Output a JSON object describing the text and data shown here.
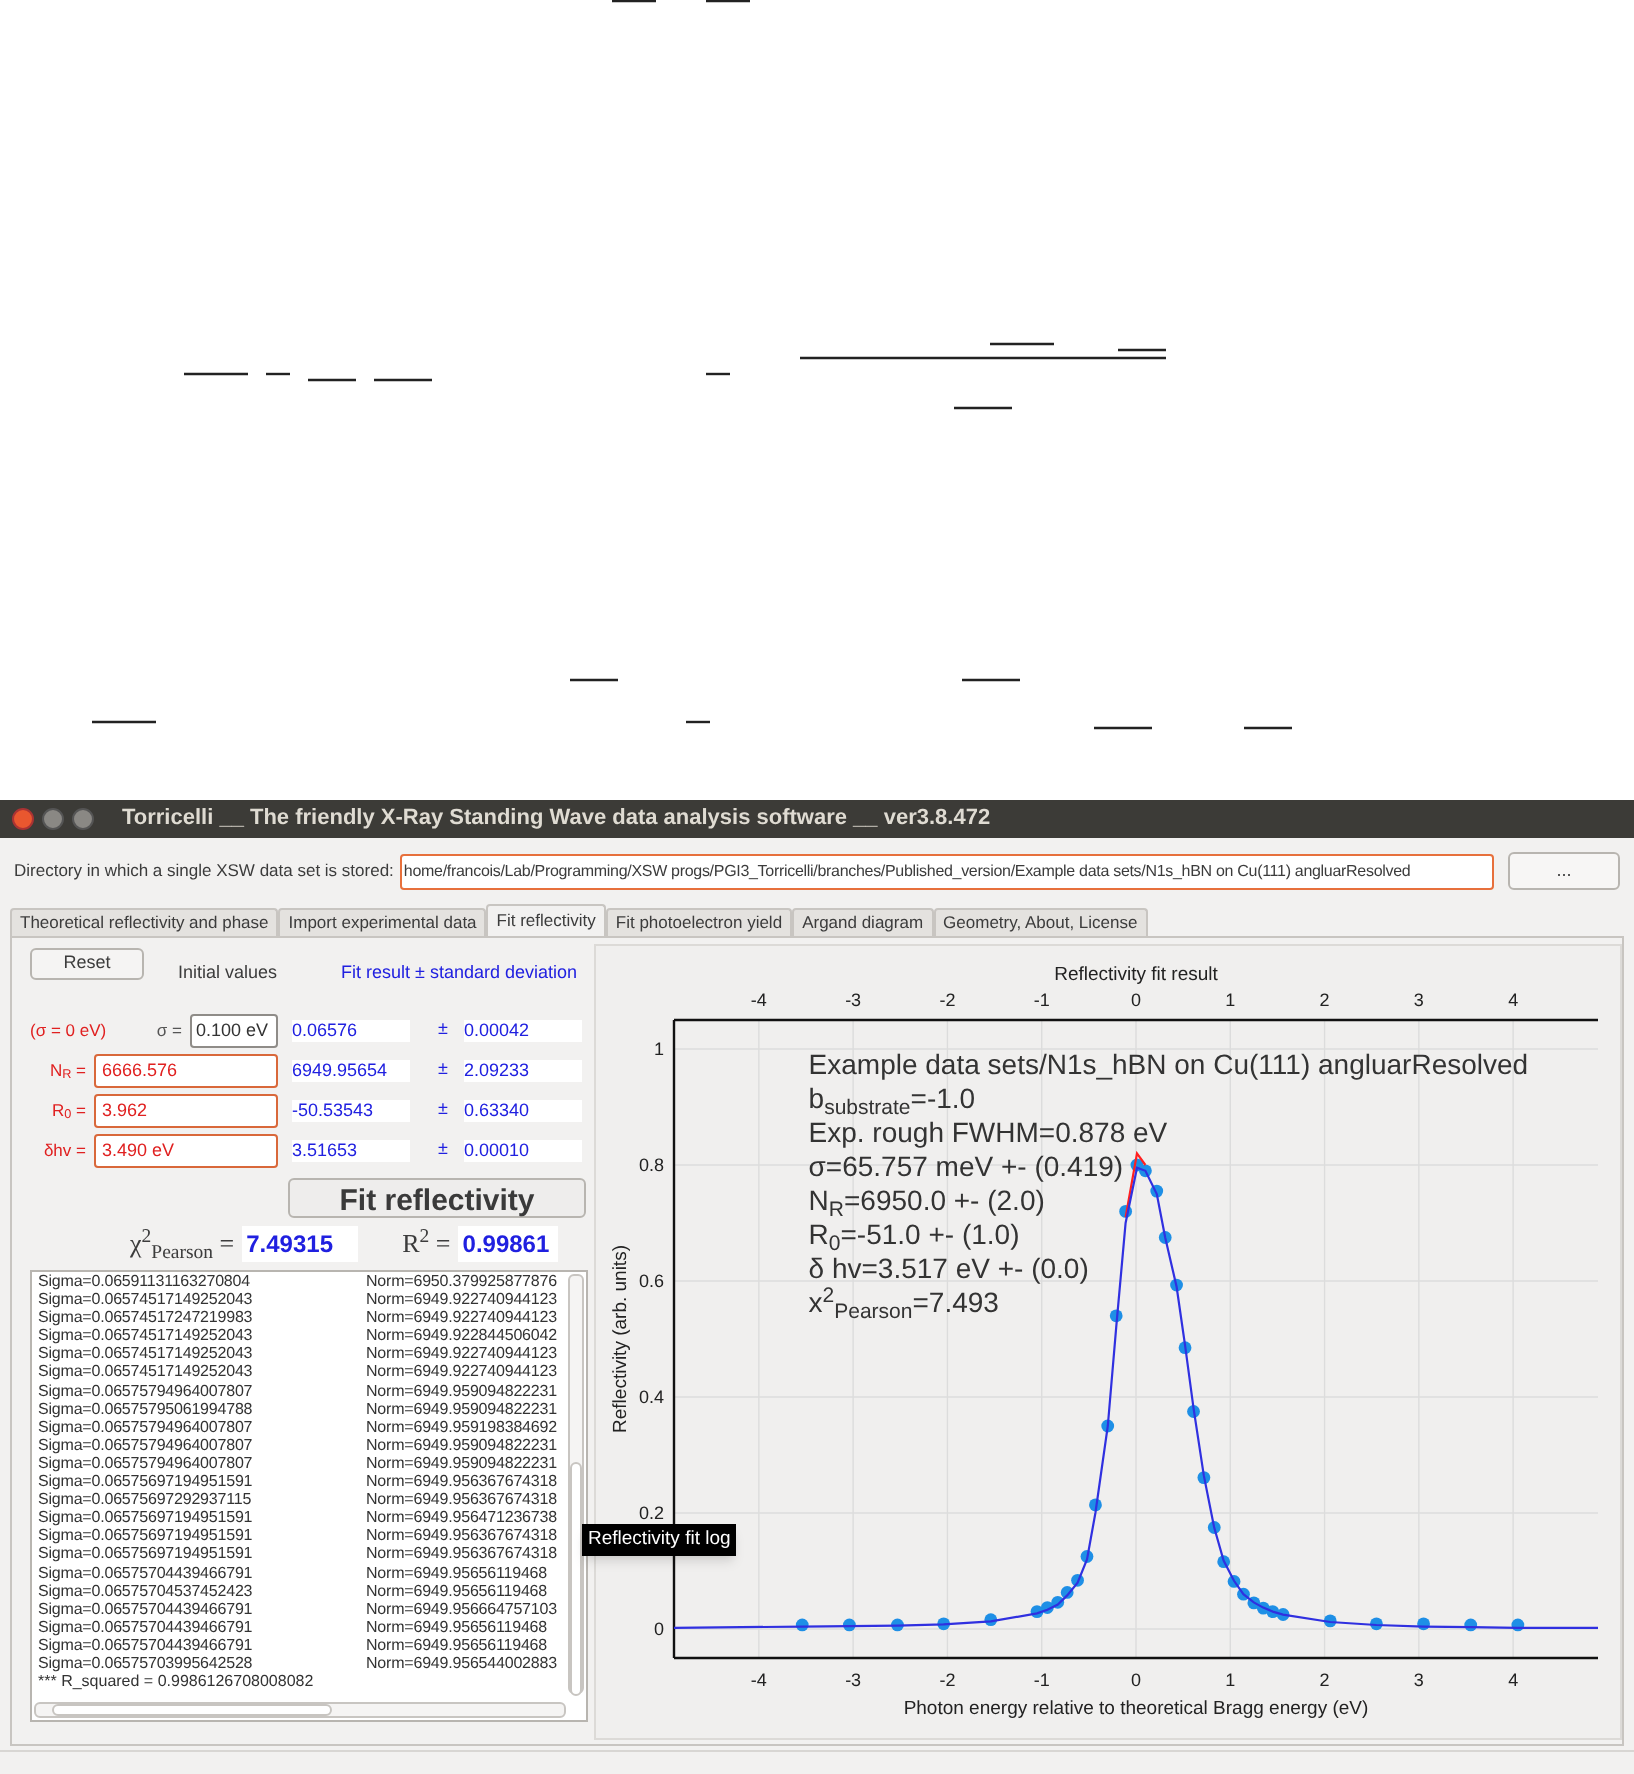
{
  "window": {
    "title": "Torricelli __ The friendly X-Ray Standing Wave data analysis software __ ver3.8.472"
  },
  "directory": {
    "label": "Directory in which a single XSW data set is stored:",
    "value": "home/francois/Lab/Programming/XSW progs/PGI3_Torricelli/branches/Published_version/Example data sets/N1s_hBN on Cu(111) angluarResolved",
    "button": "..."
  },
  "tabs": [
    {
      "label": "Theoretical reflectivity and phase",
      "selected": false
    },
    {
      "label": "Import experimental data",
      "selected": false
    },
    {
      "label": "Fit reflectivity",
      "selected": true
    },
    {
      "label": "Fit photoelectron yield",
      "selected": false
    },
    {
      "label": "Argand diagram",
      "selected": false
    },
    {
      "label": "Geometry, About, License",
      "selected": false
    }
  ],
  "fit_panel": {
    "reset_button": "Reset",
    "initial_values_header": "Initial values",
    "fit_result_header": "Fit result ± standard deviation",
    "parameters": [
      {
        "note": "(σ = 0 eV)",
        "label": "σ =",
        "initial": "0.100 eV",
        "highlighted": false,
        "result": "0.06576",
        "pm": "±",
        "std": "0.00042"
      },
      {
        "label": "N$_{R}$ =",
        "initial": "6666.576",
        "highlighted": true,
        "result": "6949.95654",
        "pm": "±",
        "std": "2.09233"
      },
      {
        "label": "R$_{0}$ =",
        "initial": "3.962",
        "highlighted": true,
        "result": "-50.53543",
        "pm": "±",
        "std": "0.63340"
      },
      {
        "label": "δhv =",
        "initial": "3.490 eV",
        "highlighted": true,
        "result": "3.51653",
        "pm": "±",
        "std": "0.00010"
      }
    ],
    "fit_button": "Fit reflectivity",
    "chi2_label": "χ$^{2}$$_{Pearson}$ =",
    "chi2_value": "7.49315",
    "r2_label": "R$^{2}$ =",
    "r2_value": "0.99861",
    "log": [
      {
        "sigma": "Sigma=0.06591131163270804",
        "norm": "Norm=6950.379925877876"
      },
      {
        "sigma": "Sigma=0.06574517149252043",
        "norm": "Norm=6949.922740944123"
      },
      {
        "sigma": "Sigma=0.06574517247219983",
        "norm": "Norm=6949.922740944123"
      },
      {
        "sigma": "Sigma=0.06574517149252043",
        "norm": "Norm=6949.922844506042"
      },
      {
        "sigma": "Sigma=0.06574517149252043",
        "norm": "Norm=6949.922740944123"
      },
      {
        "sigma": "Sigma=0.06574517149252043",
        "norm": "Norm=6949.922740944123"
      },
      {
        "sigma": "Sigma=0.06575794964007807",
        "norm": "Norm=6949.959094822231"
      },
      {
        "sigma": "Sigma=0.06575795061994788",
        "norm": "Norm=6949.959094822231"
      },
      {
        "sigma": "Sigma=0.06575794964007807",
        "norm": "Norm=6949.959198384692"
      },
      {
        "sigma": "Sigma=0.06575794964007807",
        "norm": "Norm=6949.959094822231"
      },
      {
        "sigma": "Sigma=0.06575794964007807",
        "norm": "Norm=6949.959094822231"
      },
      {
        "sigma": "Sigma=0.06575697194951591",
        "norm": "Norm=6949.956367674318"
      },
      {
        "sigma": "Sigma=0.06575697292937115",
        "norm": "Norm=6949.956367674318"
      },
      {
        "sigma": "Sigma=0.06575697194951591",
        "norm": "Norm=6949.956471236738"
      },
      {
        "sigma": "Sigma=0.06575697194951591",
        "norm": "Norm=6949.956367674318"
      },
      {
        "sigma": "Sigma=0.06575697194951591",
        "norm": "Norm=6949.956367674318"
      },
      {
        "sigma": "Sigma=0.06575704439466791",
        "norm": "Norm=6949.95656119468"
      },
      {
        "sigma": "Sigma=0.06575704537452423",
        "norm": "Norm=6949.95656119468"
      },
      {
        "sigma": "Sigma=0.06575704439466791",
        "norm": "Norm=6949.956664757103"
      },
      {
        "sigma": "Sigma=0.06575704439466791",
        "norm": "Norm=6949.95656119468"
      },
      {
        "sigma": "Sigma=0.06575704439466791",
        "norm": "Norm=6949.95656119468"
      },
      {
        "sigma": "Sigma=0.06575703995642528",
        "norm": "Norm=6949.956544002883"
      }
    ],
    "log_summary": "*** R_squared = 0.9986126708008082",
    "tooltip": "Reflectivity fit log"
  },
  "plot": {
    "top_axis_labels": [
      "-4",
      "-3",
      "-2",
      "-1",
      "0",
      "1",
      "2",
      "3",
      "4"
    ],
    "chart_data": {
      "type": "line",
      "title": "Reflectivity fit result",
      "xlabel": "Photon energy relative to theoretical Bragg energy (eV)",
      "ylabel": "Reflectivity (arb. units)",
      "x": [
        -4.9,
        -3.54,
        -3.04,
        -2.53,
        -2.04,
        -1.54,
        -1.05,
        -0.94,
        -0.83,
        -0.73,
        -0.62,
        -0.52,
        -0.43,
        -0.3,
        -0.21,
        -0.11,
        0.01,
        0.1,
        0.22,
        0.31,
        0.43,
        0.52,
        0.61,
        0.72,
        0.83,
        0.93,
        1.04,
        1.14,
        1.25,
        1.35,
        1.45,
        1.56,
        2.06,
        2.55,
        3.05,
        3.55,
        4.05,
        4.9
      ],
      "series": [
        {
          "type": "scatter",
          "color": "#1e8fe6",
          "values": [
            null,
            0.007,
            0.007,
            0.007,
            0.009,
            0.016,
            0.03,
            0.037,
            0.046,
            0.063,
            0.084,
            0.125,
            0.214,
            0.35,
            0.54,
            0.72,
            0.8,
            0.79,
            0.755,
            0.675,
            0.593,
            0.485,
            0.375,
            0.261,
            0.175,
            0.116,
            0.082,
            0.06,
            0.045,
            0.036,
            0.03,
            0.025,
            0.014,
            0.009,
            0.009,
            0.007,
            0.007,
            null
          ]
        },
        {
          "type": "line",
          "color": "#ff2020",
          "values": [
            null,
            null,
            null,
            null,
            null,
            null,
            null,
            null,
            null,
            null,
            null,
            null,
            null,
            null,
            null,
            0.71,
            0.82,
            0.8,
            null,
            null,
            null,
            null,
            null,
            null,
            null,
            null,
            null,
            null,
            null,
            null,
            null,
            null,
            null,
            null,
            null,
            null,
            null,
            null
          ]
        },
        {
          "type": "line",
          "color": "#3030e0",
          "values": [
            0.002,
            0.004,
            0.005,
            0.006,
            0.008,
            0.013,
            0.027,
            0.033,
            0.042,
            0.058,
            0.08,
            0.12,
            0.2,
            0.35,
            0.52,
            0.7,
            0.795,
            0.79,
            0.75,
            0.675,
            0.59,
            0.49,
            0.38,
            0.265,
            0.175,
            0.118,
            0.083,
            0.06,
            0.046,
            0.037,
            0.03,
            0.025,
            0.012,
            0.007,
            0.004,
            0.003,
            0.002,
            0.002
          ]
        }
      ],
      "xlim": [
        -4.9,
        4.9
      ],
      "ylim": [
        -0.05,
        1.05
      ],
      "grid": true,
      "xticks": [
        {
          "value": -4,
          "label": "-4"
        },
        {
          "value": -3,
          "label": "-3"
        },
        {
          "value": -2,
          "label": "-2"
        },
        {
          "value": -1,
          "label": "-1"
        },
        {
          "value": 0,
          "label": "0"
        },
        {
          "value": 1,
          "label": "1"
        },
        {
          "value": 2,
          "label": "2"
        },
        {
          "value": 3,
          "label": "3"
        },
        {
          "value": 4,
          "label": "4"
        }
      ],
      "yticks": [
        0,
        0.2,
        0.4,
        0.6,
        0.8,
        {
          "value": 1,
          "label": "1"
        }
      ],
      "annotations": [
        "Example data sets/N1s_hBN on Cu(111) angluarResolved",
        "b$_{substrate}$=-1.0",
        "Exp. rough FWHM=0.878 eV",
        "σ=65.757 meV +- (0.419)",
        "N$_{R}$=6950.0 +- (2.0)",
        "R$_{0}$=-51.0 +- (1.0)",
        "δ hv=3.517 eV +- (0.0)",
        "x$^{2}$$_{Pearson}$=7.493"
      ]
    }
  }
}
